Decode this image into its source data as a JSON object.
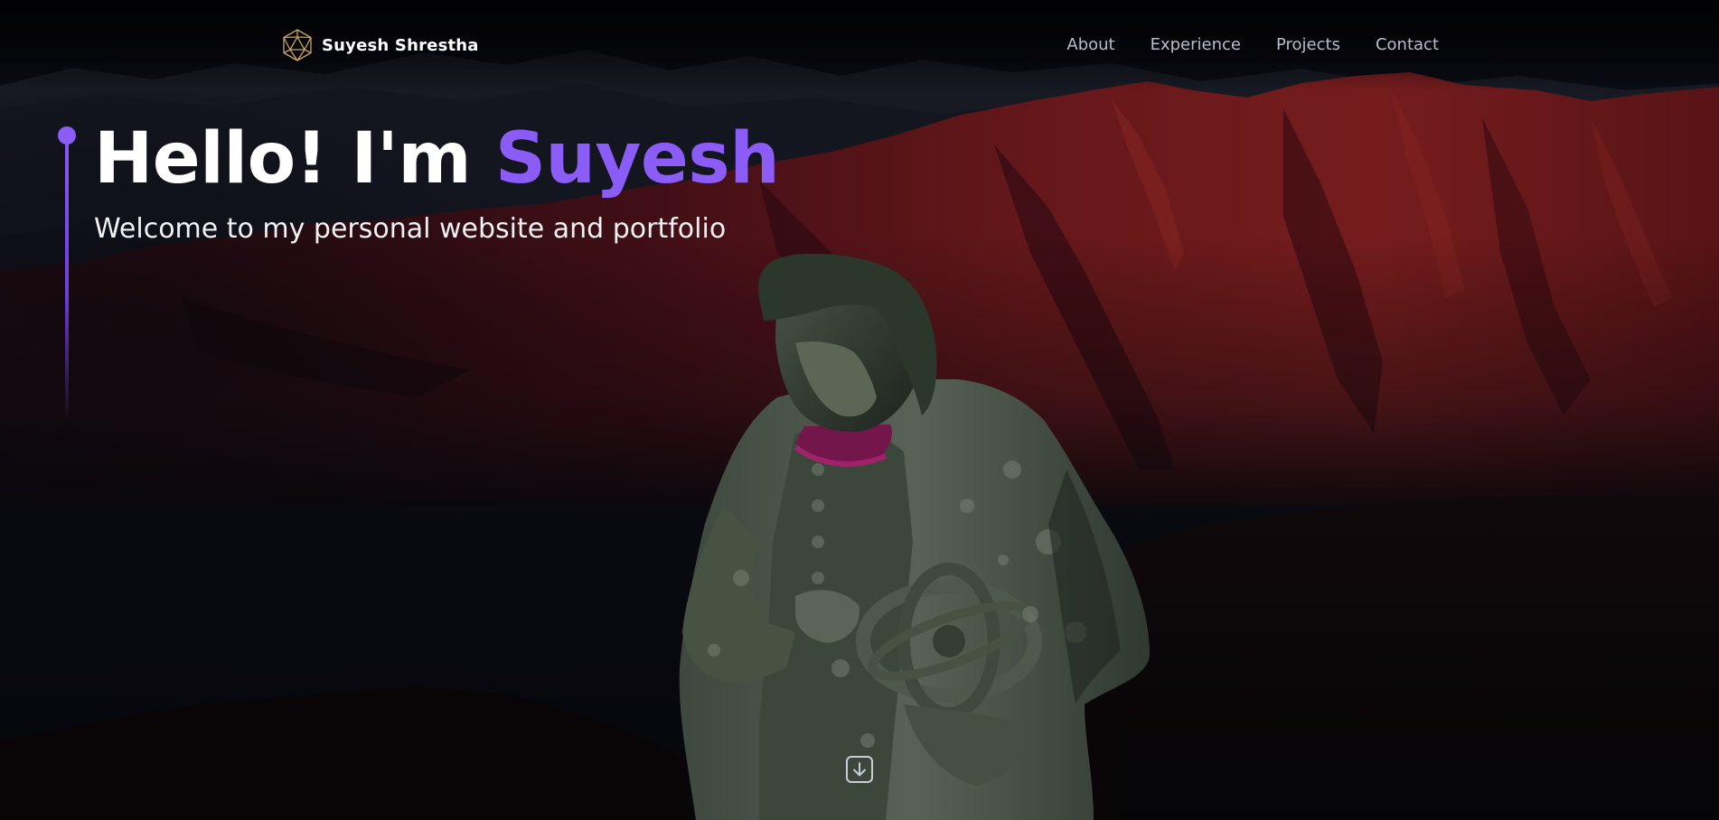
{
  "brand": {
    "name": "Suyesh Shrestha",
    "logo_icon": "icosahedron-icon"
  },
  "nav": {
    "items": [
      {
        "label": "About"
      },
      {
        "label": "Experience"
      },
      {
        "label": "Projects"
      },
      {
        "label": "Contact"
      }
    ]
  },
  "hero": {
    "greeting": "Hello! I'm",
    "name": "Suyesh",
    "subtitle": "Welcome to my personal website and portfolio",
    "scroll_icon": "arrow-down-icon"
  },
  "colors": {
    "accent": "#8b5cf6",
    "background": "#07080d",
    "nav_text": "#b9bccb",
    "logo_gold": "#c9a55c"
  }
}
